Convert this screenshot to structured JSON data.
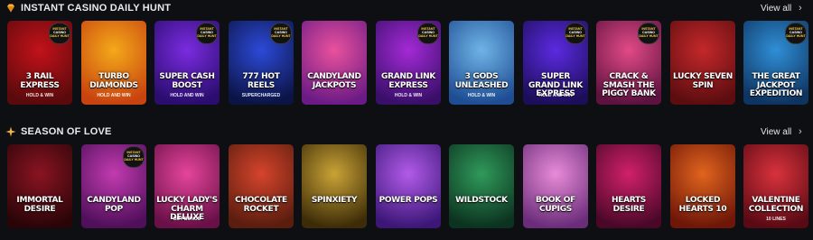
{
  "sections": [
    {
      "title": "INSTANT CASINO DAILY HUNT",
      "icon": "gem-icon",
      "view_all": "View all",
      "games": [
        {
          "title": "3 RAIL EXPRESS",
          "sub": "HOLD & WIN",
          "bg1": "#c3121a",
          "bg2": "#5a0a0c",
          "badge": true
        },
        {
          "title": "TURBO DIAMONDS",
          "sub": "HOLD AND WIN",
          "bg1": "#f4a91a",
          "bg2": "#c8430f",
          "badge": false
        },
        {
          "title": "SUPER CASH BOOST",
          "sub": "HOLD AND WIN",
          "bg1": "#7b2be0",
          "bg2": "#2a0d6e",
          "badge": true
        },
        {
          "title": "777 HOT REELS",
          "sub": "SUPERCHARGED",
          "bg1": "#2c4ad8",
          "bg2": "#0c1446",
          "badge": true
        },
        {
          "title": "CANDYLAND JACKPOTS",
          "sub": "",
          "bg1": "#e9519c",
          "bg2": "#6c1b86",
          "badge": false
        },
        {
          "title": "GRAND LINK EXPRESS",
          "sub": "HOLD & WIN",
          "bg1": "#a42ad6",
          "bg2": "#3a0f6a",
          "badge": true
        },
        {
          "title": "3 GODS UNLEASHED",
          "sub": "HOLD & WIN",
          "bg1": "#6fb4e6",
          "bg2": "#1e4d94",
          "badge": false
        },
        {
          "title": "SUPER GRAND LINK EXPRESS",
          "sub": "HOLD AND WIN",
          "bg1": "#5b2ae0",
          "bg2": "#1d0e5c",
          "badge": true
        },
        {
          "title": "CRACK & SMASH THE PIGGY BANK",
          "sub": "",
          "bg1": "#e24a86",
          "bg2": "#5e1240",
          "badge": true
        },
        {
          "title": "LUCKY SEVEN SPIN",
          "sub": "",
          "bg1": "#c4282a",
          "bg2": "#5d0d10",
          "badge": false
        },
        {
          "title": "THE GREAT JACKPOT EXPEDITION",
          "sub": "",
          "bg1": "#2f8fd6",
          "bg2": "#0e3461",
          "badge": true
        }
      ]
    },
    {
      "title": "SEASON OF LOVE",
      "icon": "sparkle-icon",
      "view_all": "View all",
      "games": [
        {
          "title": "IMMORTAL DESIRE",
          "sub": "",
          "bg1": "#8a1422",
          "bg2": "#2a0508",
          "badge": false
        },
        {
          "title": "CANDYLAND POP",
          "sub": "",
          "bg1": "#c23bb0",
          "bg2": "#4f0f5a",
          "badge": true
        },
        {
          "title": "LUCKY LADY'S CHARM DELUXE",
          "sub": "BUY BONUS",
          "bg1": "#e5459b",
          "bg2": "#6a1048",
          "badge": false
        },
        {
          "title": "CHOCOLATE ROCKET",
          "sub": "",
          "bg1": "#d5442c",
          "bg2": "#5a1d0e",
          "badge": false
        },
        {
          "title": "SPINXIETY",
          "sub": "",
          "bg1": "#caa336",
          "bg2": "#3d2c08",
          "badge": false
        },
        {
          "title": "POWER POPS",
          "sub": "",
          "bg1": "#b25be9",
          "bg2": "#3c1778",
          "badge": false
        },
        {
          "title": "WILDSTOCK",
          "sub": "",
          "bg1": "#2f9a5a",
          "bg2": "#0c3320",
          "badge": false
        },
        {
          "title": "BOOK OF CUPIGS",
          "sub": "",
          "bg1": "#e88bd8",
          "bg2": "#6b2d7a",
          "badge": false
        },
        {
          "title": "HEARTS DESIRE",
          "sub": "",
          "bg1": "#d1206a",
          "bg2": "#4a0828",
          "badge": false
        },
        {
          "title": "LOCKED HEARTS 10",
          "sub": "",
          "bg1": "#e0641e",
          "bg2": "#6e1608",
          "badge": false
        },
        {
          "title": "VALENTINE COLLECTION",
          "sub": "10 LINES",
          "bg1": "#d9323c",
          "bg2": "#5a0a14",
          "badge": false
        }
      ]
    }
  ],
  "badge_text": {
    "l1": "INSTANT",
    "l2": "CASINO",
    "l3": "DAILY HUNT"
  },
  "chevron": "›"
}
